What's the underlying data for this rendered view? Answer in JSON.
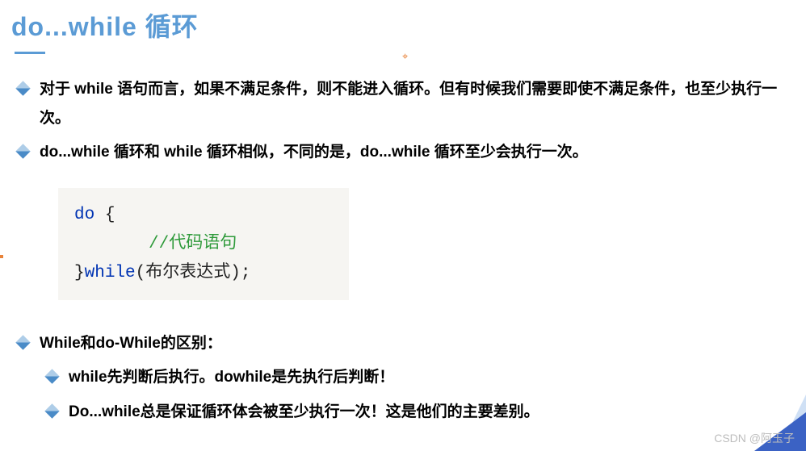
{
  "title": "do...while 循环",
  "bullets": {
    "b1": "对于 while 语句而言，如果不满足条件，则不能进入循环。但有时候我们需要即使不满足条件，也至少执行一次。",
    "b2": "do...while 循环和 while 循环相似，不同的是，do...while 循环至少会执行一次。",
    "b3": "While和do-While的区别：",
    "b3a": "while先判断后执行。dowhile是先执行后判断！",
    "b3b": "Do...while总是保证循环体会被至少执行一次！这是他们的主要差别。"
  },
  "code": {
    "line1_kw": "do",
    "line1_rest": " {",
    "line2_comment": "//代码语句",
    "line3_brace": "}",
    "line3_kw": "while",
    "line3_rest": "(布尔表达式);"
  },
  "watermark": "CSDN @阿玉子",
  "anchor_symbol": "⌖"
}
